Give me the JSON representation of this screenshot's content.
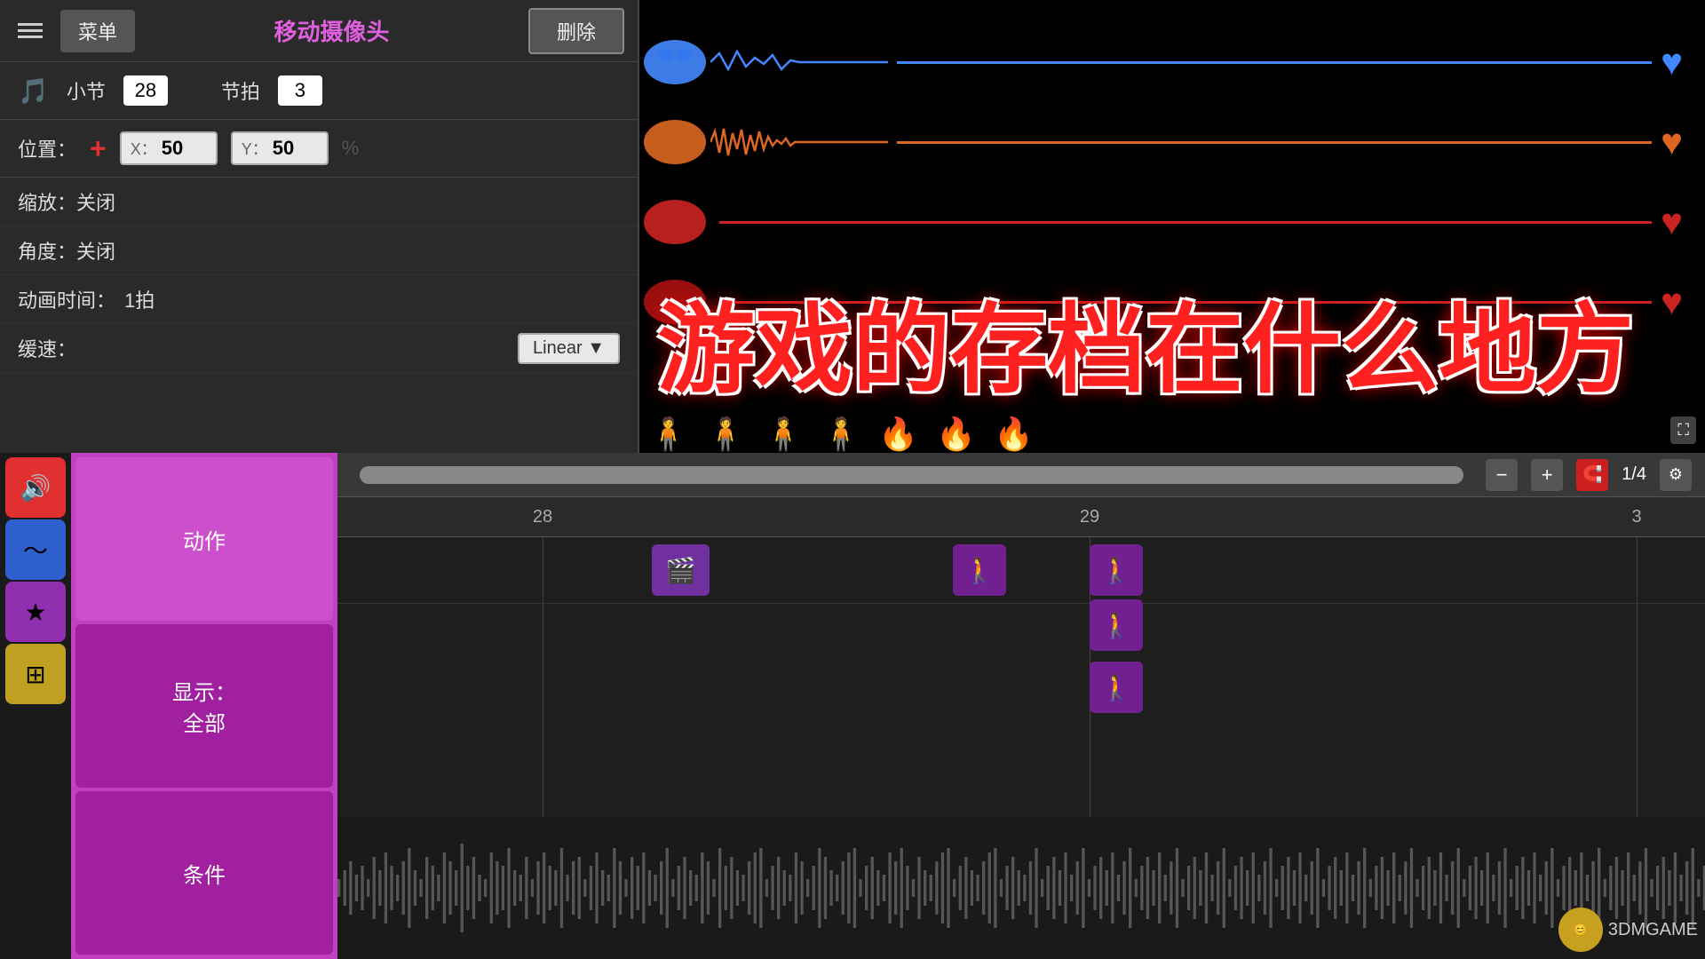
{
  "topbar": {
    "menu_label": "菜单",
    "title": "移动摄像头",
    "delete_label": "删除"
  },
  "controls": {
    "measure_label": "小节",
    "measure_value": "28",
    "beat_label": "节拍",
    "beat_value": "3",
    "position_label": "位置：",
    "x_label": "X：",
    "x_value": "50",
    "y_label": "Y：",
    "y_value": "50",
    "scale_label": "缩放：关闭",
    "angle_label": "角度：关闭",
    "anim_label": "动画时间：",
    "anim_value": "1拍",
    "ease_label": "缓速：",
    "ease_value": "Linear"
  },
  "timeline": {
    "minus_label": "−",
    "plus_label": "+",
    "fraction_label": "1/4",
    "measure_28": "28",
    "measure_29": "29",
    "measure_3": "3"
  },
  "sidebar": {
    "btn_sound": "🔊",
    "btn_wave": "〜",
    "btn_star": "★",
    "btn_grid": "⊞"
  },
  "categories": {
    "action_label": "动作",
    "display_label": "显示：\n全部",
    "condition_label": "条件"
  },
  "overlay": {
    "text": "游戏的存档在什么地方"
  },
  "watermark": {
    "logo": "3DM",
    "site": "3DMGAME"
  },
  "preview": {
    "char_lines": [
      {
        "color": "blue"
      },
      {
        "color": "orange"
      },
      {
        "color": "red"
      },
      {
        "color": "darkred"
      }
    ]
  }
}
